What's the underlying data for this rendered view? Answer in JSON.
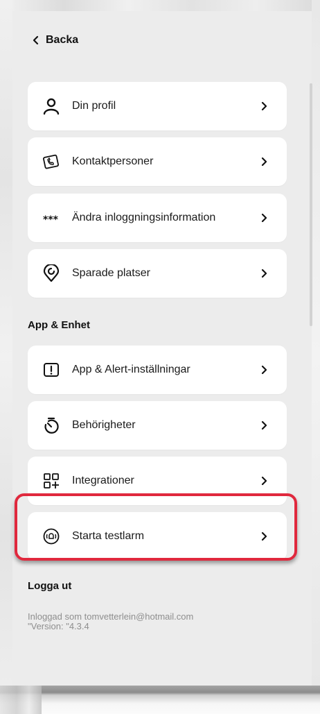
{
  "nav": {
    "back_label": "Backa"
  },
  "account_items": [
    {
      "label": "Din profil",
      "icon": "person-icon"
    },
    {
      "label": "Kontaktpersoner",
      "icon": "contact-card-icon"
    },
    {
      "label": "Ändra inloggningsinformation",
      "icon": "password-dots-icon"
    },
    {
      "label": "Sparade platser",
      "icon": "location-pin-icon"
    }
  ],
  "app_section": {
    "title": "App & Enhet",
    "items": [
      {
        "label": "App & Alert-inställningar",
        "icon": "alert-square-icon"
      },
      {
        "label": "Behörigheter",
        "icon": "stopwatch-icon"
      },
      {
        "label": "Integrationer",
        "icon": "grid-add-icon"
      },
      {
        "label": "Starta testlarm",
        "icon": "alarm-broadcast-icon"
      }
    ]
  },
  "logout": {
    "label": "Logga ut"
  },
  "meta": {
    "logged_in": "Inloggad som tomvetterlein@hotmail.com",
    "version": "\"Version: \"4.3.4"
  },
  "colors": {
    "highlight": "#e0283d",
    "card": "#ffffff",
    "background": "#ececec"
  }
}
